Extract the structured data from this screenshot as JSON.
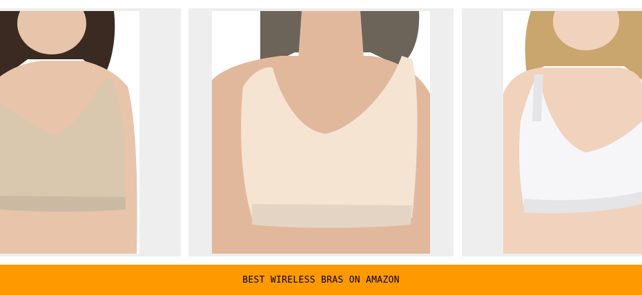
{
  "products": [
    {
      "image_name": "product-photo-nude-wireless-bra",
      "bra_color": "#d9c8ad",
      "skin_color": "#e8c4ab",
      "hair_color": "#3a2a22"
    },
    {
      "image_name": "product-photo-cream-wireless-bra",
      "bra_color": "#f5e4d2",
      "skin_color": "#e2b89c",
      "hair_color": "#6d6459"
    },
    {
      "image_name": "product-photo-white-wireless-bra",
      "bra_color": "#f6f6f8",
      "skin_color": "#f0d2bd",
      "hair_color": "#c9a66e"
    }
  ],
  "banner": {
    "text": "BEST WIRELESS BRAS ON AMAZON",
    "background": "#ff9900",
    "text_color": "#000000"
  }
}
